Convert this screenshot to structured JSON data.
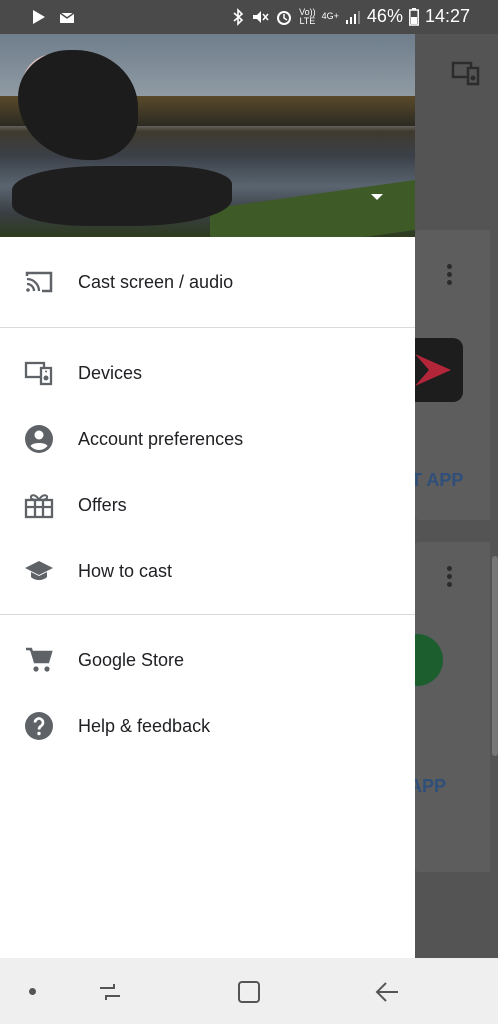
{
  "status_bar": {
    "volte": "Vo))",
    "lte": "LTE",
    "network": "4G+",
    "battery": "46%",
    "time": "14:27"
  },
  "background_app": {
    "card1_action": "T APP",
    "card2_action": "APP"
  },
  "drawer": {
    "menu": {
      "section1": [
        {
          "label": "Cast screen / audio",
          "icon": "cast-icon"
        }
      ],
      "section2": [
        {
          "label": "Devices",
          "icon": "devices-icon"
        },
        {
          "label": "Account preferences",
          "icon": "account-circle-icon"
        },
        {
          "label": "Offers",
          "icon": "gift-icon"
        },
        {
          "label": "How to cast",
          "icon": "school-icon"
        }
      ],
      "section3": [
        {
          "label": "Google Store",
          "icon": "cart-icon"
        },
        {
          "label": "Help & feedback",
          "icon": "help-icon"
        }
      ]
    }
  },
  "colors": {
    "icon": "#5f6368",
    "text": "#202124",
    "divider": "#dadada"
  }
}
